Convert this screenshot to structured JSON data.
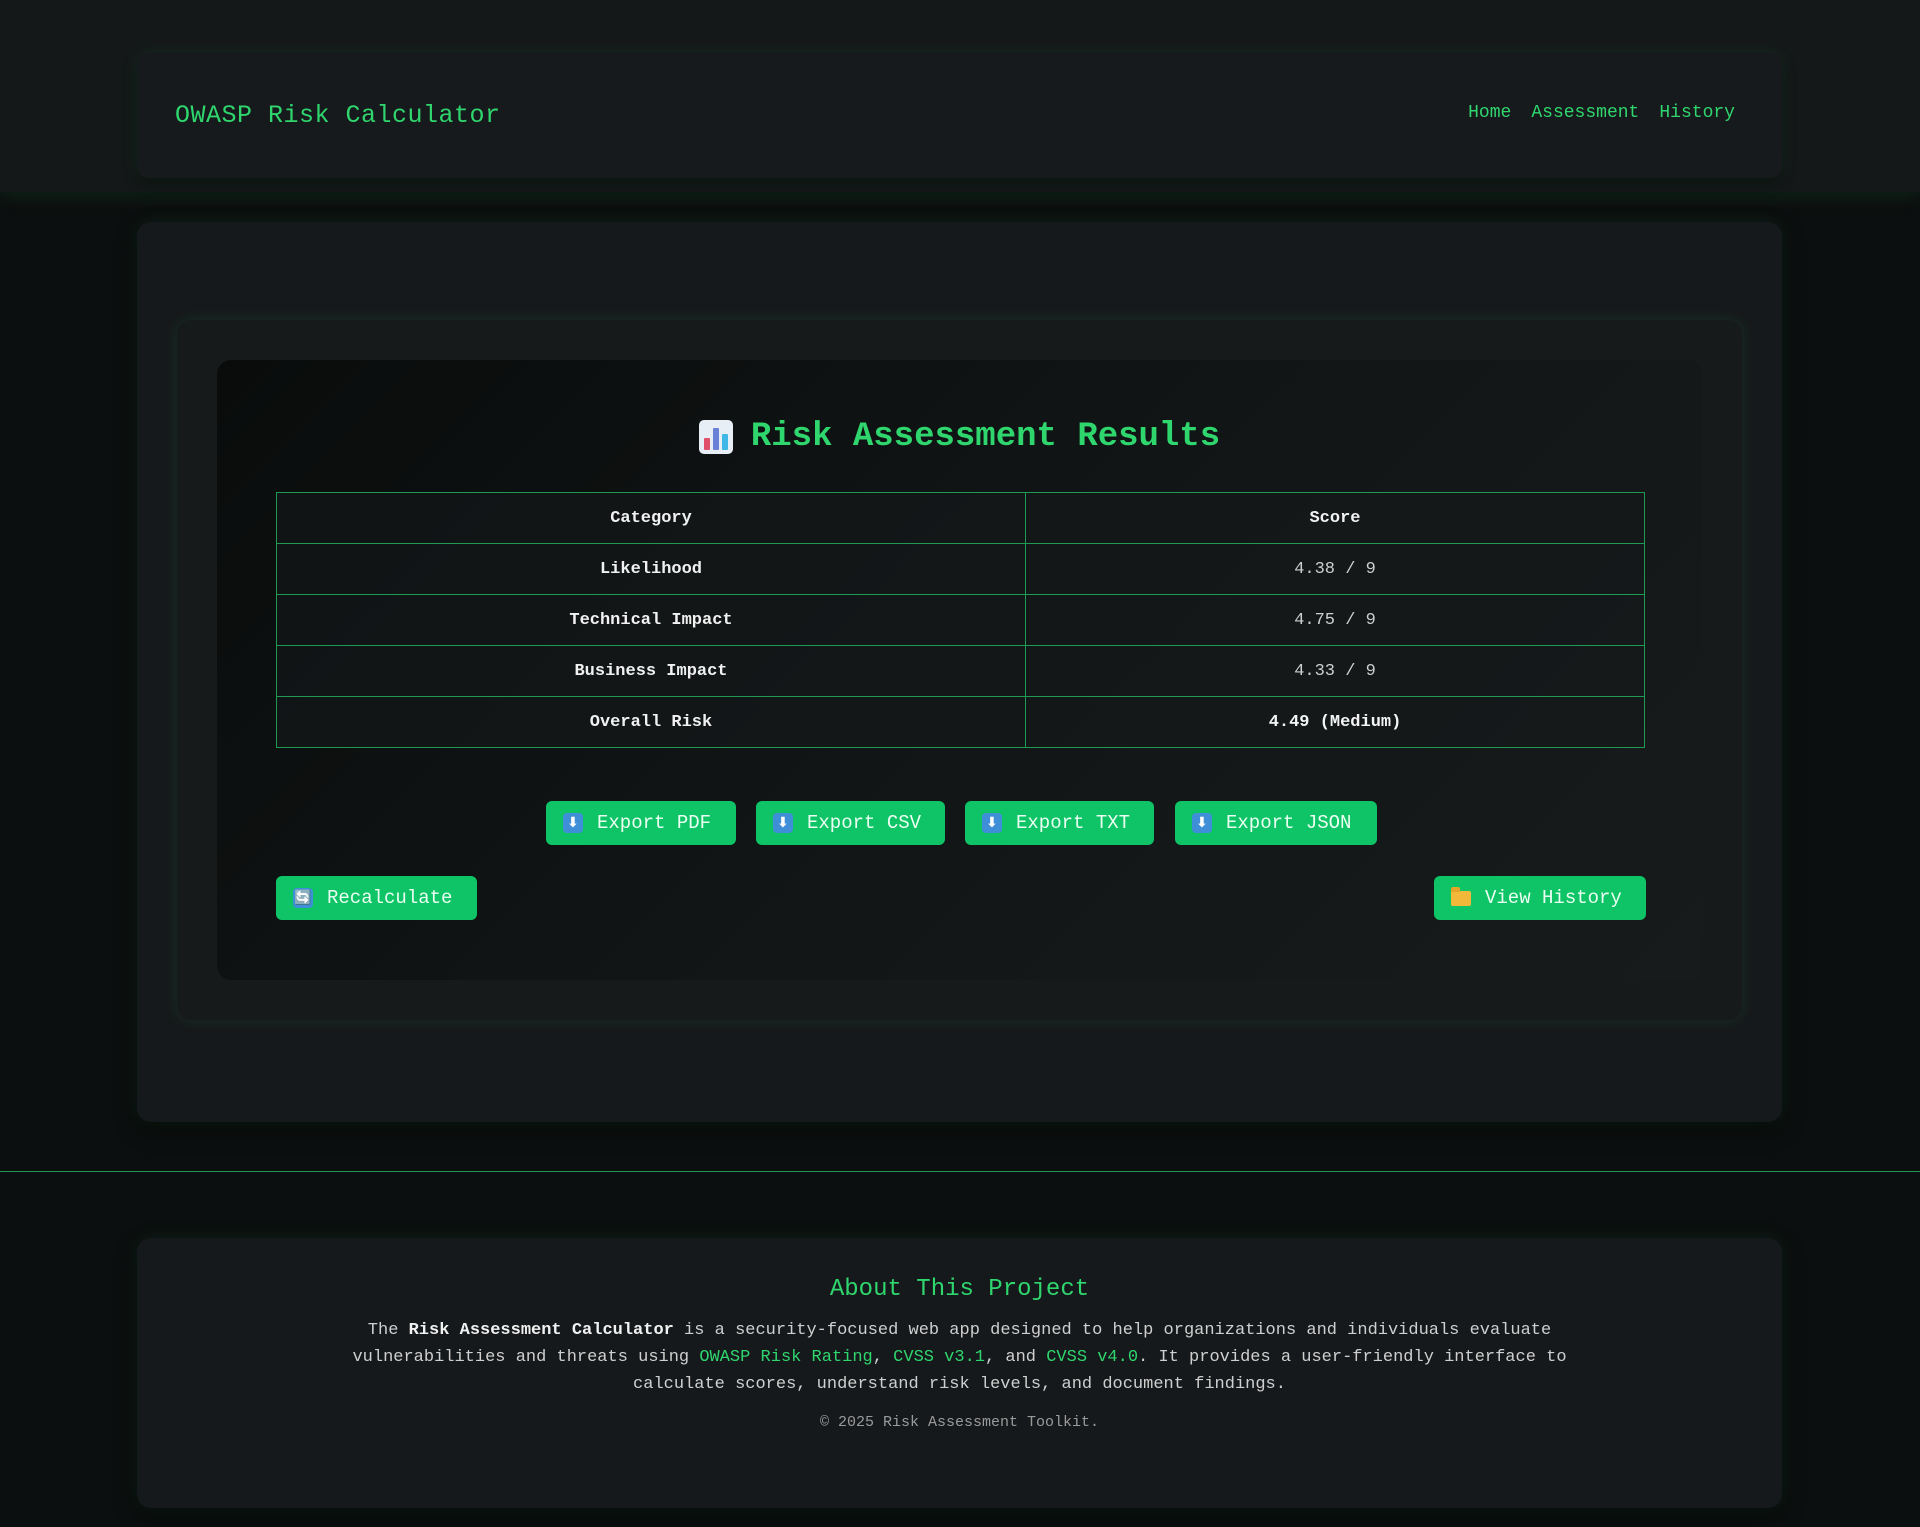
{
  "nav": {
    "brand": "OWASP Risk Calculator",
    "links": [
      "Home",
      "Assessment",
      "History"
    ]
  },
  "results": {
    "title": "Risk Assessment Results",
    "title_icon": "bar-chart-icon",
    "headers": [
      "Category",
      "Score"
    ],
    "rows": [
      {
        "category": "Likelihood",
        "score": "4.38 / 9"
      },
      {
        "category": "Technical Impact",
        "score": "4.75 / 9"
      },
      {
        "category": "Business Impact",
        "score": "4.33 / 9"
      },
      {
        "category": "Overall Risk",
        "score": "4.49 (Medium)"
      }
    ]
  },
  "export_buttons": {
    "pdf": "Export PDF",
    "csv": "Export CSV",
    "txt": "Export TXT",
    "json": "Export JSON",
    "icon": "⬇"
  },
  "actions": {
    "recalculate": "Recalculate",
    "recalculate_icon": "🔄",
    "view_history": "View History"
  },
  "about": {
    "title": "About This Project",
    "text_1": "The ",
    "app_name": "Risk Assessment Calculator",
    "text_2": " is a security-focused web app designed to help organizations and individuals evaluate vulnerabilities and threats using ",
    "link_owasp": "OWASP Risk Rating",
    "sep_1": ", ",
    "link_cvss31": "CVSS v3.1",
    "sep_2": ", and ",
    "link_cvss40": "CVSS v4.0",
    "text_3": ". It provides a user-friendly interface to calculate scores, understand risk levels, and document findings.",
    "copyright": "© 2025 Risk Assessment Toolkit."
  },
  "colors": {
    "accent": "#2fd66e",
    "button": "#0ec467",
    "border": "#1f9a52",
    "background": "#0c0f0f",
    "card": "#16191b"
  }
}
